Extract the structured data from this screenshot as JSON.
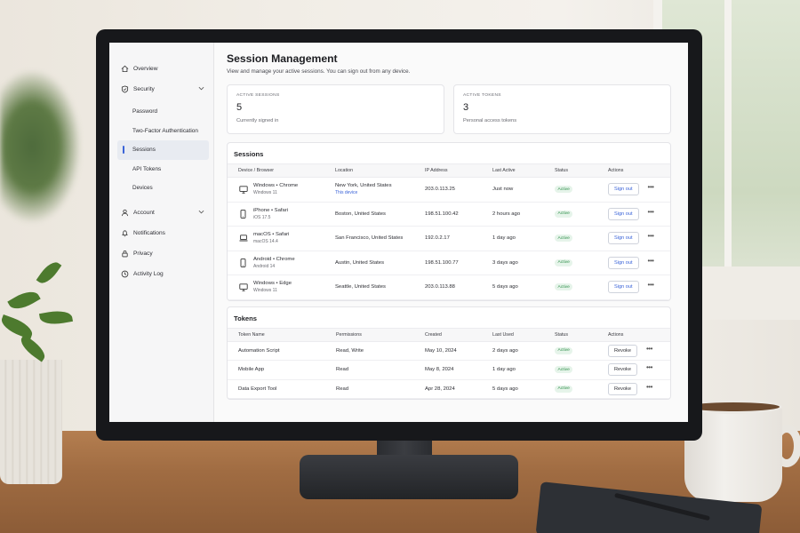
{
  "sidebar": {
    "overview": "Overview",
    "security": "Security",
    "security_items": [
      "Password",
      "Two-Factor Authentication",
      "Sessions",
      "API Tokens",
      "Devices"
    ],
    "account": "Account",
    "notifications": "Notifications",
    "privacy": "Privacy",
    "activity_log": "Activity Log"
  },
  "header": {
    "title": "Session Management",
    "subtitle": "View and manage your active sessions. You can sign out from any device."
  },
  "stats": {
    "sessions": {
      "label": "ACTIVE SESSIONS",
      "value": "5",
      "caption": "Currently signed in"
    },
    "tokens": {
      "label": "ACTIVE TOKENS",
      "value": "3",
      "caption": "Personal access tokens"
    }
  },
  "sessions": {
    "title": "Sessions",
    "columns": [
      "Device / Browser",
      "Location",
      "IP Address",
      "Last Active",
      "Status",
      "Actions"
    ],
    "rows": [
      {
        "device": "Windows • Chrome",
        "os": "Windows 11",
        "icon": "monitor-icon",
        "location": "New York, United States",
        "note": "This device",
        "ip": "203.0.113.25",
        "last_active": "Just now",
        "status": "Active",
        "action": "Sign out"
      },
      {
        "device": "iPhone • Safari",
        "os": "iOS 17.5",
        "icon": "phone-icon",
        "location": "Boston, United States",
        "note": "",
        "ip": "198.51.100.42",
        "last_active": "2 hours ago",
        "status": "Active",
        "action": "Sign out"
      },
      {
        "device": "macOS • Safari",
        "os": "macOS 14.4",
        "icon": "laptop-icon",
        "location": "San Francisco, United States",
        "note": "",
        "ip": "192.0.2.17",
        "last_active": "1 day ago",
        "status": "Active",
        "action": "Sign out"
      },
      {
        "device": "Android • Chrome",
        "os": "Android 14",
        "icon": "phone-icon",
        "location": "Austin, United States",
        "note": "",
        "ip": "198.51.100.77",
        "last_active": "3 days ago",
        "status": "Active",
        "action": "Sign out"
      },
      {
        "device": "Windows • Edge",
        "os": "Windows 11",
        "icon": "monitor-icon",
        "location": "Seattle, United States",
        "note": "",
        "ip": "203.0.113.88",
        "last_active": "5 days ago",
        "status": "Active",
        "action": "Sign out"
      }
    ]
  },
  "tokens": {
    "title": "Tokens",
    "columns": [
      "Token Name",
      "Permissions",
      "Created",
      "Last Used",
      "Status",
      "Actions"
    ],
    "rows": [
      {
        "name": "Automation Script",
        "permissions": "Read, Write",
        "created": "May 10, 2024",
        "last_used": "2 days ago",
        "status": "Active",
        "action": "Revoke"
      },
      {
        "name": "Mobile App",
        "permissions": "Read",
        "created": "May 8, 2024",
        "last_used": "1 day ago",
        "status": "Active",
        "action": "Revoke"
      },
      {
        "name": "Data Export Tool",
        "permissions": "Read",
        "created": "Apr 28, 2024",
        "last_used": "5 days ago",
        "status": "Active",
        "action": "Revoke"
      }
    ]
  },
  "colors": {
    "accent": "#3a63d8",
    "status_active": "#2f8f4a"
  }
}
